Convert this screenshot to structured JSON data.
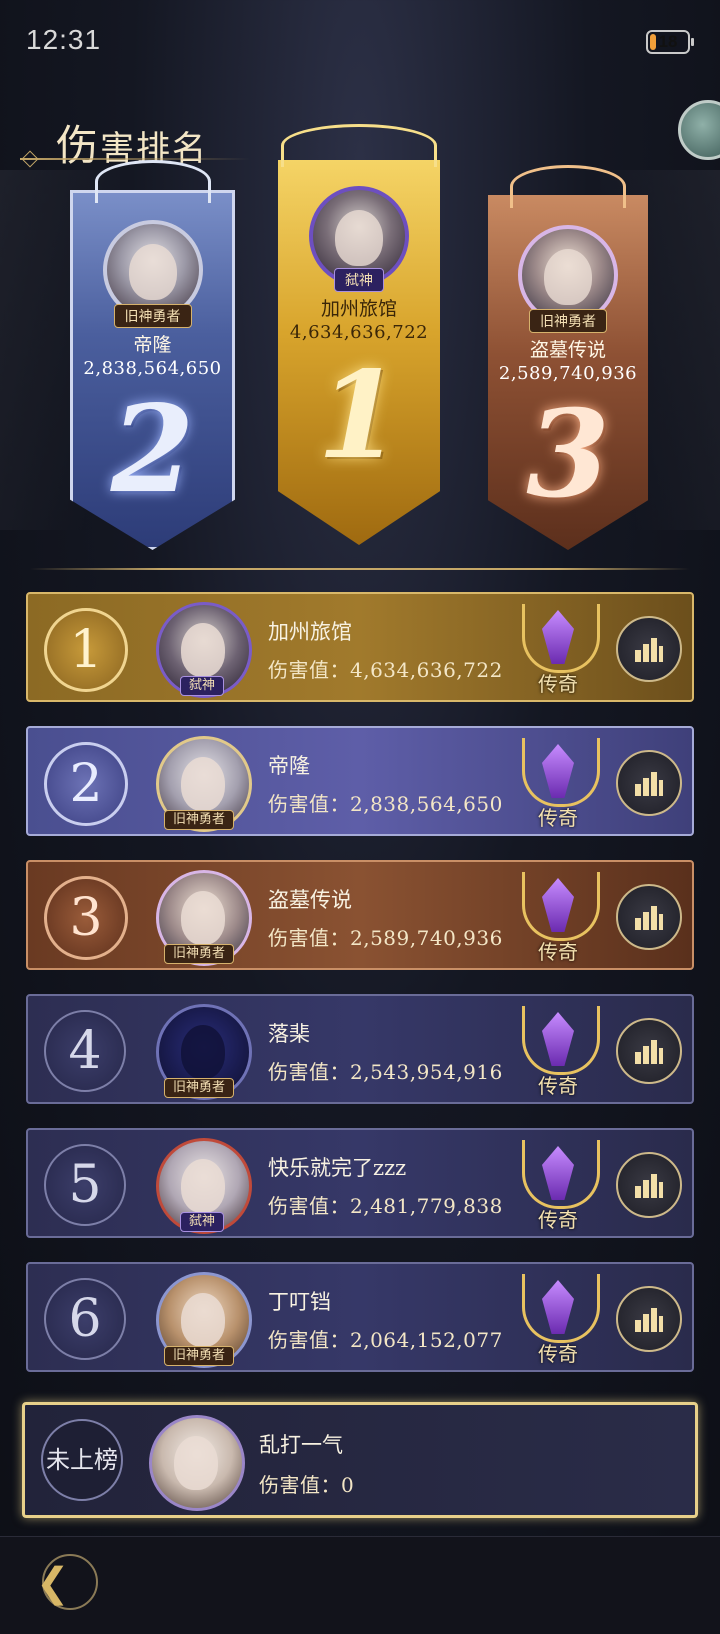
{
  "status_bar": {
    "time": "12:31",
    "battery": "18",
    "battery_fill": 0.18
  },
  "title": {
    "first": "伤",
    "rest": "害排名"
  },
  "podium": [
    {
      "rank": "2",
      "tag": "旧神勇者",
      "name": "帝隆",
      "score": "2,838,564,650"
    },
    {
      "rank": "1",
      "tag": "弑神",
      "name": "加州旅馆",
      "score": "4,634,636,722"
    },
    {
      "rank": "3",
      "tag": "旧神勇者",
      "name": "盗墓传说",
      "score": "2,589,740,936"
    }
  ],
  "rows": [
    {
      "rank": "1",
      "tag": "弑神",
      "name": "加州旅馆",
      "score_label": "伤害值：",
      "score": "4,634,636,722",
      "badge": "传奇",
      "badge_icon": "legend-badge-icon",
      "chart_icon": "bar-chart-icon"
    },
    {
      "rank": "2",
      "tag": "旧神勇者",
      "name": "帝隆",
      "score_label": "伤害值：",
      "score": "2,838,564,650",
      "badge": "传奇",
      "badge_icon": "legend-badge-icon",
      "chart_icon": "bar-chart-icon"
    },
    {
      "rank": "3",
      "tag": "旧神勇者",
      "name": "盗墓传说",
      "score_label": "伤害值：",
      "score": "2,589,740,936",
      "badge": "传奇",
      "badge_icon": "legend-badge-icon",
      "chart_icon": "bar-chart-icon"
    },
    {
      "rank": "4",
      "tag": "旧神勇者",
      "name": "落棐",
      "score_label": "伤害值：",
      "score": "2,543,954,916",
      "badge": "传奇",
      "badge_icon": "legend-badge-icon",
      "chart_icon": "bar-chart-icon"
    },
    {
      "rank": "5",
      "tag": "弑神",
      "name": "快乐就完了zzz",
      "score_label": "伤害值：",
      "score": "2,481,779,838",
      "badge": "传奇",
      "badge_icon": "legend-badge-icon",
      "chart_icon": "bar-chart-icon"
    },
    {
      "rank": "6",
      "tag": "旧神勇者",
      "name": "丁叮铛",
      "score_label": "伤害值：",
      "score": "2,064,152,077",
      "badge": "传奇",
      "badge_icon": "legend-badge-icon",
      "chart_icon": "bar-chart-icon"
    }
  ],
  "my_row": {
    "rank": "未上榜",
    "name": "乱打一气",
    "score_label": "伤害值：",
    "score": "0"
  },
  "colors": {
    "gold": "#d9b86a",
    "silver": "#a6abd8",
    "bronze": "#c98f66",
    "highlight": "#e8d08a"
  },
  "icons": {
    "back": "back-arrow-icon",
    "side": "floating-bubble-icon"
  }
}
